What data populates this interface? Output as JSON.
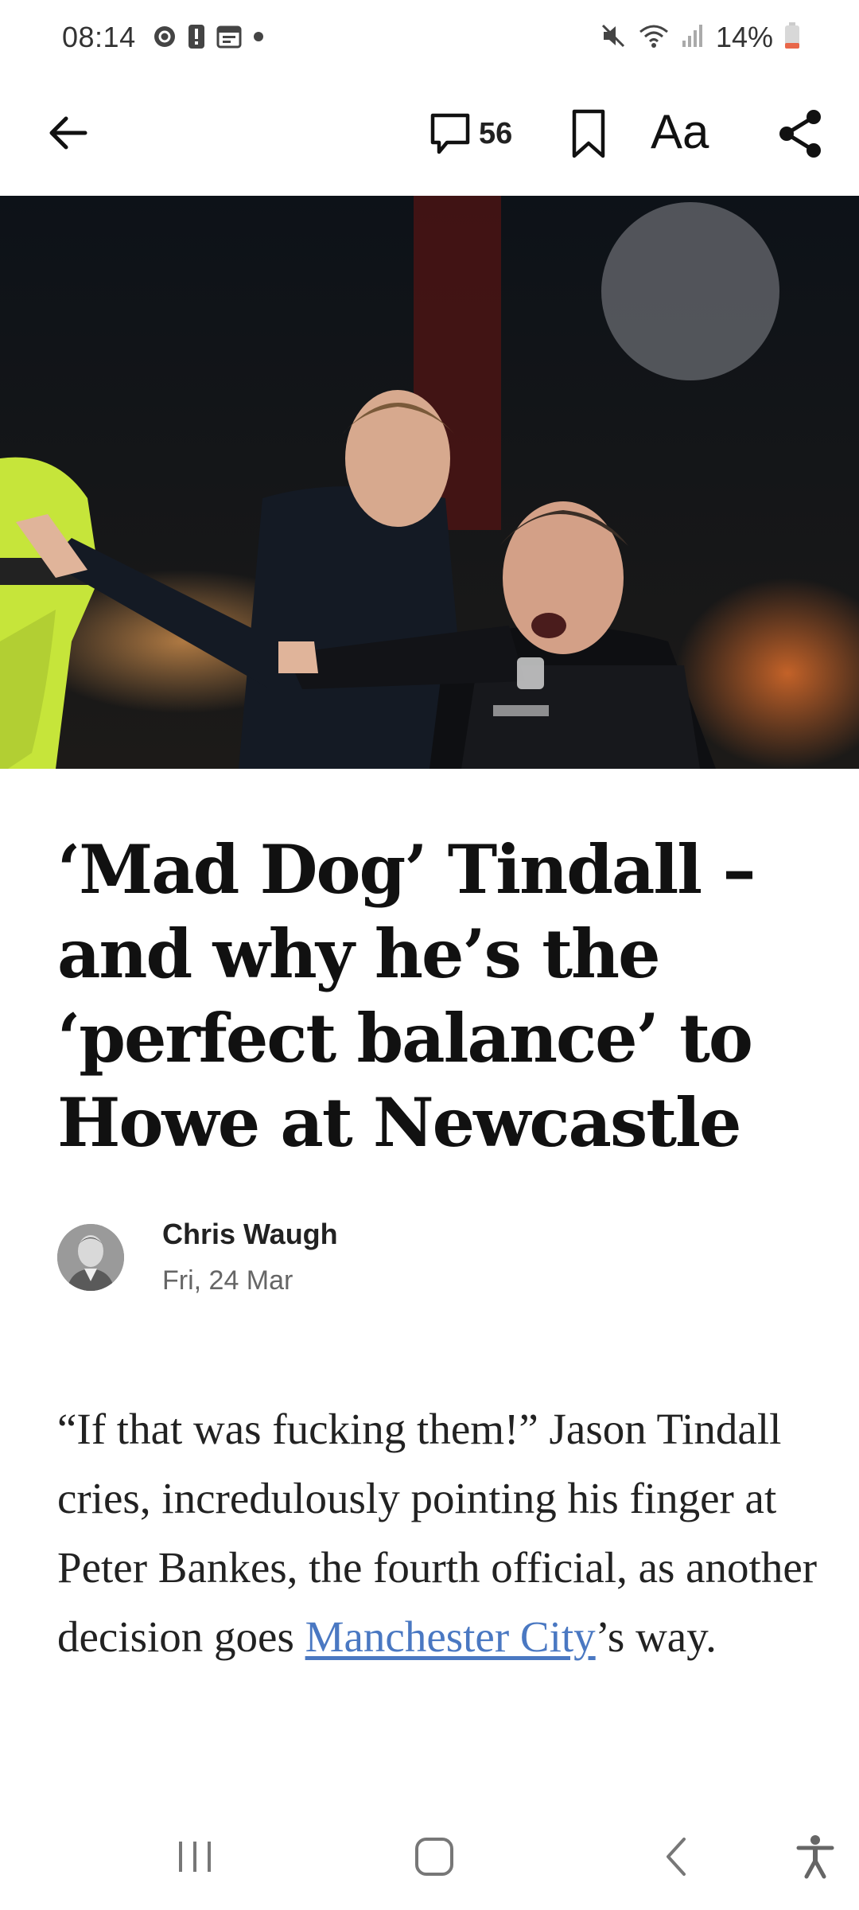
{
  "status_bar": {
    "time": "08:14",
    "battery": "14%",
    "left_icons": [
      "sync-icon",
      "alert-icon",
      "calendar-icon",
      "dot-icon"
    ],
    "right_icons": [
      "mute-icon",
      "wifi-icon",
      "signal-icon",
      "battery-icon"
    ],
    "battery_color": "#e8674a"
  },
  "toolbar": {
    "comments_count": "56",
    "text_size_label": "Aa",
    "icons": [
      "back-arrow-icon",
      "comment-icon",
      "bookmark-icon",
      "share-icon"
    ]
  },
  "article": {
    "headline": "‘Mad Dog’ Tindall – and why he’s the ‘perfect balance’ to Howe at Newcastle",
    "author": "Chris Waugh",
    "date": "Fri, 24 Mar",
    "body_before_link": "“If that was fucking them!” Jason Tindall cries, incredulously pointing his finger at Peter Bankes, the fourth official, as another decision goes ",
    "link_text": "Manchester City",
    "body_after_link": "’s way.",
    "link_color": "#4a78c2"
  },
  "nav_bar": {
    "icons": [
      "recent-apps-icon",
      "home-icon",
      "back-icon",
      "accessibility-icon"
    ]
  }
}
